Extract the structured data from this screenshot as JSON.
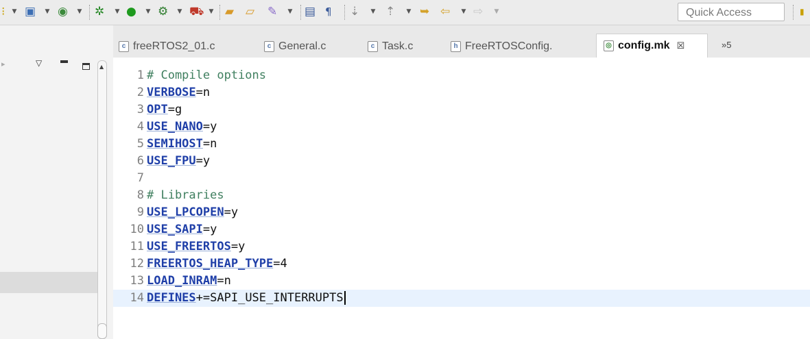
{
  "toolbar": {
    "quick_access_placeholder": "Quick Access"
  },
  "tabs": [
    {
      "label": "freeRTOS2_01.c",
      "icon": "c-source-file-icon",
      "active": false
    },
    {
      "label": "General.c",
      "icon": "c-source-file-icon",
      "active": false
    },
    {
      "label": "Task.c",
      "icon": "c-source-file-icon",
      "active": false
    },
    {
      "label": "FreeRTOSConfig.",
      "icon": "header-file-icon",
      "active": false
    },
    {
      "label": "config.mk",
      "icon": "makefile-icon",
      "active": true
    }
  ],
  "tab_close_glyph": "☒",
  "tab_overflow": "»5",
  "editor": {
    "lines": [
      {
        "n": "1",
        "comment": "# Compile options"
      },
      {
        "n": "2",
        "key": "VERBOSE",
        "op": "=",
        "val": "n"
      },
      {
        "n": "3",
        "key": "OPT",
        "op": "=",
        "val": "g"
      },
      {
        "n": "4",
        "key": "USE_NANO",
        "op": "=",
        "val": "y"
      },
      {
        "n": "5",
        "key": "SEMIHOST",
        "op": "=",
        "val": "n"
      },
      {
        "n": "6",
        "key": "USE_FPU",
        "op": "=",
        "val": "y"
      },
      {
        "n": "7"
      },
      {
        "n": "8",
        "comment": "# Libraries"
      },
      {
        "n": "9",
        "key": "USE_LPCOPEN",
        "op": "=",
        "val": "y"
      },
      {
        "n": "10",
        "key": "USE_SAPI",
        "op": "=",
        "val": "y"
      },
      {
        "n": "11",
        "key": "USE_FREERTOS",
        "op": "=",
        "val": "y"
      },
      {
        "n": "12",
        "key": "FREERTOS_HEAP_TYPE",
        "op": "=",
        "val": "4"
      },
      {
        "n": "13",
        "key": "LOAD_INRAM",
        "op": "=",
        "val": "n"
      },
      {
        "n": "14",
        "key": "DEFINES",
        "op": "+=",
        "val": "SAPI_USE_INTERRUPTS",
        "current": true
      }
    ]
  }
}
